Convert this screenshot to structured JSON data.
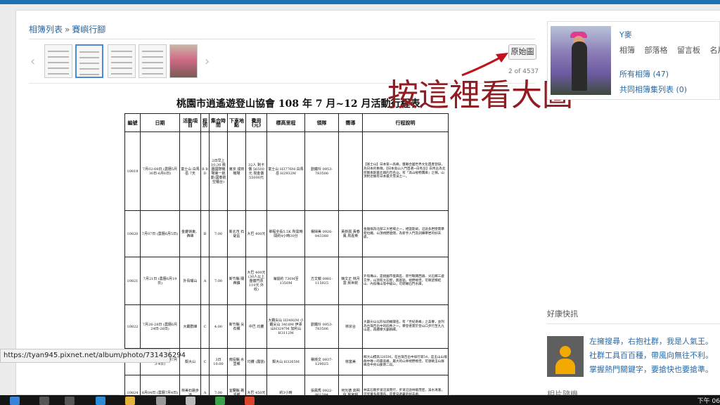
{
  "breadcrumb": {
    "album": "相簿列表",
    "sep": "»",
    "current": "賽嶼行腳"
  },
  "viewer": {
    "original_button": "原始圖",
    "counter": "2 of 4537"
  },
  "annotation": {
    "text": "按這裡看大圖",
    "color": "#8f1d22"
  },
  "document": {
    "title": "桃園市逍遙遊登山協會 108 年 7 月~12 月活動行程表",
    "headers": [
      "編號",
      "日期",
      "活動項目",
      "程別",
      "集合時間",
      "下車地點",
      "費用(元)",
      "標高里程",
      "領隊",
      "嚮導",
      "行程說明"
    ],
    "rows": [
      {
        "no": "10819",
        "date": "7月02-08日 (農曆5月30日-6月6日)",
        "event": "富士山 白馬岳 7天",
        "level": "B B D",
        "time": "2日早上 10:30 桃園國際機場第一航廈(國泰航空櫃台)",
        "place": "東京 成田機場",
        "fee": "32人 剩卡價 56500元 現金價 55000元",
        "height": "富士山 H3776M 白馬岳 H2932M",
        "leader": "劉鐵玲 0953-783506",
        "guide": "",
        "desc": "【富士山】日本第一高峰，獲聯合國世界文化遺產登錄，為日本的象徵。【日本高山入門首選~白馬岳】白馬岳為北阿爾卑斯最北端的百名山，有「高山植物寶庫」之稱，山頂附近擁有日本最大雪溪之一。"
      },
      {
        "no": "10820",
        "date": "7月07日 (農曆6月5日)",
        "event": "金雞嶺東、西峰",
        "level": "B",
        "time": "7:00",
        "place": "新北市 石碇區",
        "fee": "大巴 400元",
        "height": "單程全長5.5K 所需時間約4小時30分",
        "leader": "楊婦美 0926-843388",
        "guide": "黃新興 黃春鳳 周嘉英",
        "desc": "金雞嶺為北部三大岩場之一，相當陡峭，沿途多岩壁需攀爬拉繩，山頂視野遼闊，為新手入門及訓練攀岩的好去處。"
      },
      {
        "no": "10821",
        "date": "7月21日 (農曆6月19日)",
        "event": "外鳥嘴山",
        "level": "A",
        "time": "7:00",
        "place": "新竹縣 關西鎮",
        "fee": "大巴 400元 (30人以上團體門票110元 外收)",
        "height": "海拔約 730M至1350M",
        "leader": "方文鏡 0981-115925",
        "guide": "簡文正 林月雲 房世欽",
        "desc": "外鳥嘴山，是桃園市復興區、新竹縣關西鎮、尖石鄉三處交界，山頂有大石壁，無基點，視野極佳，可眺望那結山、內鳥嘴山等中級山，可俯瞰石門水庫。"
      },
      {
        "no": "10822",
        "date": "7月26-28日 (農曆6月24日-26日)",
        "event": "大霸群峰",
        "level": "C",
        "time": "4:00",
        "place": "新竹縣 尖石鄉",
        "fee": "中巴 均攤",
        "height": "大霸尖山 H3492M 小霸尖山 3418M 伊澤山H3297M 加利山H3112M",
        "leader": "劉鐵玲 0953-783506",
        "guide": "林宗合",
        "desc": "大霸尖山以形似酒桶聞名，有「世紀奇峰」之美譽，並列為台灣百岳中的四秀之一，攀登者需於登山口步行至九九山莊，再續攀大霸群峰。"
      },
      {
        "no": "10823",
        "date": "8月03-04日 (農曆7月3-4日)",
        "event": "鄰大山",
        "level": "C",
        "time": "3日 10:00",
        "place": "南投縣 水里鄉",
        "fee": "均攤 (露營)",
        "height": "鄰大山 H3265M",
        "leader": "楊燒文 0937-129025",
        "guide": "林富美",
        "desc": "鄰大山標高3265M，在台灣百岳中排行第54，是玉山山塊群中唯一的最高峰，屬大的山脊視野極佳，可遠眺玉山群峰及中央山脈南二段。"
      },
      {
        "no": "10824",
        "date": "8月04日 (農曆7月4日)",
        "event": "林美石磐步道",
        "level": "A",
        "time": "7:00",
        "place": "宜蘭縣 礁溪鄉",
        "fee": "大巴 450元",
        "height": "約3小時",
        "leader": "張鳳秀 0922-901394",
        "guide": "何光德 高明信 詹家娟",
        "desc": "林美石磐步道沿溪而行，步道沿途林蔭茂密，溪水清澈，可欣賞多座瀑布，是夏日避暑的好去處。"
      }
    ]
  },
  "profile": {
    "name": "Y麥",
    "links": [
      "相簿",
      "部落格",
      "留言板",
      "名片"
    ],
    "all_albums": "所有相簿 (47)",
    "shared_albums": "共同相簿集列表 (0)"
  },
  "sidebar": {
    "panel_title": "好康快訊",
    "ad_lines": [
      "左擁搜尋，右抱社群，我是人氣王。",
      "社群工具百百種，帶風向無往不利。",
      "掌握熱門關鍵字，要搶快也要搶準。"
    ],
    "panel2_title": "相片隨機"
  },
  "statusbar": {
    "url": "https://tyan945.pixnet.net/album/photo/731436294"
  },
  "taskbar": {
    "clock": "下午 06"
  }
}
